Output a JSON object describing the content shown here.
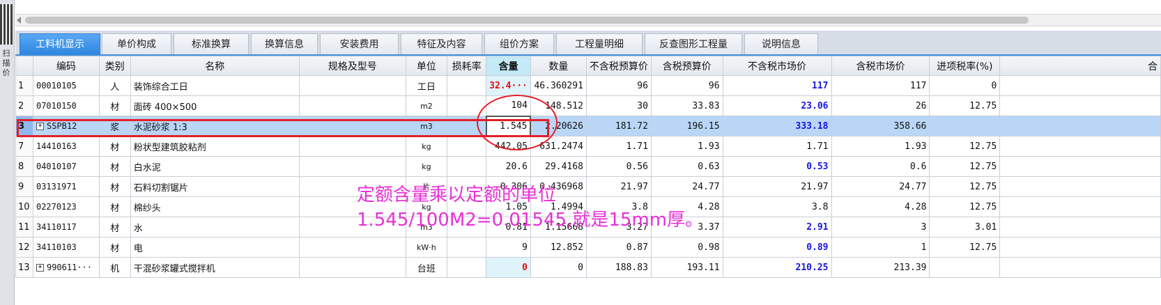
{
  "side_label": "扫\n描价",
  "tabs": [
    "工料机显示",
    "单价构成",
    "标准换算",
    "换算信息",
    "安装费用",
    "特征及内容",
    "组价方案",
    "工程量明细",
    "反查图形工程量",
    "说明信息"
  ],
  "columns": [
    "编码",
    "类别",
    "名称",
    "规格及型号",
    "单位",
    "损耗率",
    "含量",
    "数量",
    "不含税预算价",
    "含税预算价",
    "不含税市场价",
    "含税市场价",
    "进项税率(%)",
    "合"
  ],
  "rows": [
    {
      "no": "1",
      "code": "00010105",
      "type": "人",
      "name": "装饰综合工日",
      "spec": "",
      "unit": "工日",
      "loss": "",
      "content": "32.4···",
      "qty": "46.360291",
      "pre_budget": "96",
      "tax_budget": "96",
      "pre_market": "117",
      "tax_market": "117",
      "rate": "0"
    },
    {
      "no": "2",
      "code": "07010150",
      "type": "材",
      "name": "面砖 400×500",
      "spec": "",
      "unit": "m2",
      "loss": "",
      "content": "104",
      "qty": "148.512",
      "pre_budget": "30",
      "tax_budget": "33.83",
      "pre_market": "23.06",
      "tax_market": "26",
      "rate": "12.75"
    },
    {
      "no": "3",
      "code": "SSPB12",
      "type": "浆",
      "name": "水泥砂浆 1:3",
      "spec": "",
      "unit": "m3",
      "loss": "",
      "content": "1.545",
      "qty": "2.20626",
      "pre_budget": "181.72",
      "tax_budget": "196.15",
      "pre_market": "333.18",
      "tax_market": "358.66",
      "rate": ""
    },
    {
      "no": "7",
      "code": "14410163",
      "type": "材",
      "name": "粉状型建筑胶粘剂",
      "spec": "",
      "unit": "kg",
      "loss": "",
      "content": "442.05",
      "qty": "631.2474",
      "pre_budget": "1.71",
      "tax_budget": "1.93",
      "pre_market": "1.71",
      "tax_market": "1.93",
      "rate": "12.75"
    },
    {
      "no": "8",
      "code": "04010107",
      "type": "材",
      "name": "白水泥",
      "spec": "",
      "unit": "kg",
      "loss": "",
      "content": "20.6",
      "qty": "29.4168",
      "pre_budget": "0.56",
      "tax_budget": "0.63",
      "pre_market": "0.53",
      "tax_market": "0.6",
      "rate": "12.75"
    },
    {
      "no": "9",
      "code": "03131971",
      "type": "材",
      "name": "石料切割锯片",
      "spec": "",
      "unit": "片",
      "loss": "",
      "content": "0.306",
      "qty": "0.436968",
      "pre_budget": "21.97",
      "tax_budget": "24.77",
      "pre_market": "21.97",
      "tax_market": "24.77",
      "rate": "12.75"
    },
    {
      "no": "10",
      "code": "02270123",
      "type": "材",
      "name": "棉纱头",
      "spec": "",
      "unit": "kg",
      "loss": "",
      "content": "1.05",
      "qty": "1.4994",
      "pre_budget": "3.8",
      "tax_budget": "4.28",
      "pre_market": "3.8",
      "tax_market": "4.28",
      "rate": "12.75"
    },
    {
      "no": "11",
      "code": "34110117",
      "type": "材",
      "name": "水",
      "spec": "",
      "unit": "m3",
      "loss": "",
      "content": "0.81",
      "qty": "1.15668",
      "pre_budget": "3.27",
      "tax_budget": "3.37",
      "pre_market": "2.91",
      "tax_market": "3",
      "rate": "3.01"
    },
    {
      "no": "12",
      "code": "34110103",
      "type": "材",
      "name": "电",
      "spec": "",
      "unit": "kW·h",
      "loss": "",
      "content": "9",
      "qty": "12.852",
      "pre_budget": "0.87",
      "tax_budget": "0.98",
      "pre_market": "0.89",
      "tax_market": "1",
      "rate": "12.75"
    },
    {
      "no": "13",
      "code": "990611···",
      "type": "机",
      "name": "干混砂浆罐式搅拌机",
      "spec": "",
      "unit": "台班",
      "loss": "",
      "content": "0",
      "qty": "0",
      "pre_budget": "188.83",
      "tax_budget": "193.11",
      "pre_market": "210.25",
      "tax_market": "213.39",
      "rate": ""
    }
  ],
  "note_line1": "定额含量乘以定额的单位",
  "note_line2": "1.545/100M2=0.01545,就是15mm厚。",
  "colors": {
    "annotation_red": "#e41e26",
    "note_pink": "#e830d8",
    "market_blue": "#1515e0",
    "selected_row": "#b9d6f7",
    "active_tab": "#2f86e0"
  }
}
